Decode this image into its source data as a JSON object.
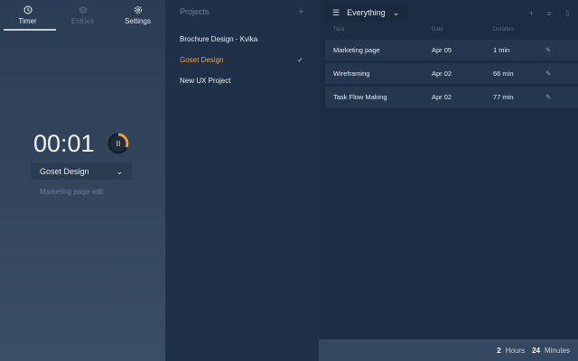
{
  "tabs": [
    {
      "label": "Timer",
      "icon": "clock-icon"
    },
    {
      "label": "Entries",
      "icon": "layers-icon"
    },
    {
      "label": "Settings",
      "icon": "gear-icon"
    }
  ],
  "timer": {
    "time": "00:01",
    "project": "Goset Design",
    "task_placeholder": "Marketing page edit",
    "accent": "#f0a030"
  },
  "projects": {
    "title": "Projects",
    "items": [
      "Brochure Design - Kvika",
      "Goset Design",
      "New UX Project"
    ],
    "selected": "Goset Design"
  },
  "entries": {
    "filter": "Everything",
    "columns": [
      "Task",
      "Date",
      "Duration"
    ],
    "rows": [
      {
        "task": "Marketing page",
        "date": "Apr 05",
        "duration": "1 min"
      },
      {
        "task": "Wireframing",
        "date": "Apr 02",
        "duration": "66 min"
      },
      {
        "task": "Task Flow Making",
        "date": "Apr 02",
        "duration": "77 min"
      }
    ]
  },
  "total": {
    "hours": "2",
    "hours_label": "Hours",
    "minutes": "24",
    "minutes_label": "Minutes"
  }
}
